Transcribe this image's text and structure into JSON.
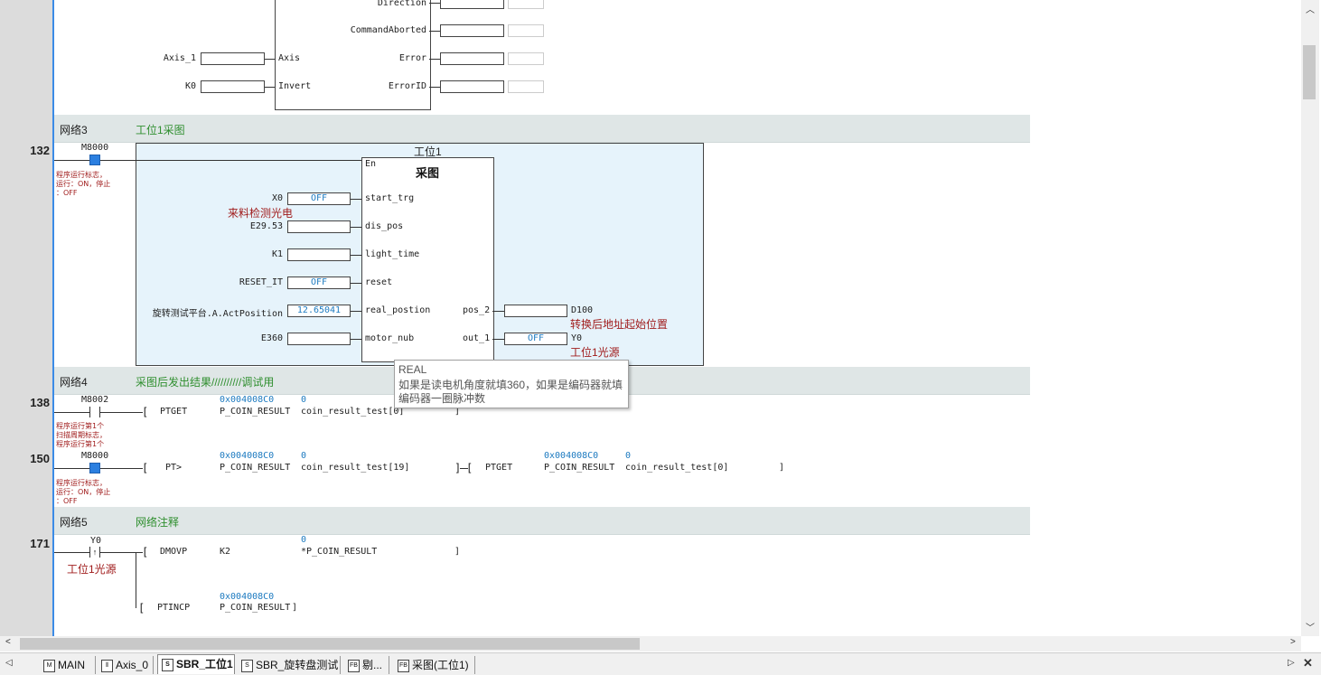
{
  "fb_top": {
    "pins_left": [
      {
        "label": "Axis_1",
        "pin": "Axis"
      },
      {
        "label": "K0",
        "pin": "Invert"
      }
    ],
    "pins_right": [
      "Direction",
      "CommandAborted",
      "Error",
      "ErrorID"
    ]
  },
  "rows": {
    "r132": "132",
    "r138": "138",
    "r150": "150",
    "r171": "171"
  },
  "networks": [
    {
      "name": "网络3",
      "comment": "工位1采图"
    },
    {
      "name": "网络4",
      "comment": "采图后发出结果//////////调试用"
    },
    {
      "name": "网络5",
      "comment": "网络注释"
    }
  ],
  "net3": {
    "contact": "M8000",
    "contact_comment": [
      "程序运行标志，",
      "运行：ON，停止",
      "：OFF"
    ],
    "instance": "工位1",
    "block_title": "采图",
    "en": "En",
    "inputs": [
      {
        "var": "X0",
        "value": "OFF",
        "pin": "start_trg",
        "comment": "来料检测光电"
      },
      {
        "var": "E29.53",
        "value": "",
        "pin": "dis_pos"
      },
      {
        "var": "K1",
        "value": "",
        "pin": "light_time"
      },
      {
        "var": "RESET_IT",
        "value": "OFF",
        "pin": "reset"
      },
      {
        "var": "旋转测试平台.A.ActPosition",
        "value": "12.65041",
        "pin": "real_postion"
      },
      {
        "var": "E360",
        "value": "",
        "pin": "motor_nub"
      }
    ],
    "outputs": [
      {
        "pin": "pos_2",
        "value": "",
        "var": "D100",
        "comment": "转换后地址起始位置"
      },
      {
        "pin": "out_1",
        "value": "OFF",
        "var": "Y0",
        "comment": "工位1光源"
      }
    ]
  },
  "tooltip": {
    "type": "REAL",
    "line1": "如果是读电机角度就填360，如果是编码器就填",
    "line2": "编码器一圈脉冲数"
  },
  "net4": {
    "r138": {
      "contact": "M8002",
      "comment": [
        "程序运行第1个",
        "扫描周期标志，",
        "程序运行第1个"
      ],
      "instr": "PTGET",
      "addr": "0x004008C0",
      "op1": "P_COIN_RESULT",
      "val": "0",
      "op2": "coin_result_test[0]",
      "close": "]"
    },
    "r150": {
      "contact": "M8000",
      "comment": [
        "程序运行标志，",
        "运行：ON，停止",
        "：OFF"
      ],
      "instr1": "PT>",
      "addr1": "0x004008C0",
      "op1": "P_COIN_RESULT",
      "val1": "0",
      "op1b": "coin_result_test[19]",
      "instr2": "PTGET",
      "addr2": "0x004008C0",
      "op2": "P_COIN_RESULT",
      "val2": "0",
      "op2b": "coin_result_test[0]",
      "close": "]"
    }
  },
  "net5": {
    "contact": "Y0",
    "contact_comment": "工位1光源",
    "instr1": "DMOVP",
    "op1": "K2",
    "val1": "0",
    "op1b": "*P_COIN_RESULT",
    "close": "]",
    "instr2": "PTINCP",
    "addr2": "0x004008C0",
    "op2": "P_COIN_RESULT",
    "close2": "]"
  },
  "tabs": [
    "MAIN",
    "Axis_0",
    "SBR_工位1",
    "SBR_旋转盘测试",
    "剔...",
    "采图(工位1)"
  ],
  "tab_icons": [
    "M",
    "⫴",
    "S",
    "S",
    "FB",
    "FB"
  ],
  "colors": {
    "accent": "#2b7fe0",
    "network_bg": "#dfe6e6",
    "fb_bg": "#e6f3fb",
    "comment_green": "#2f8f2f",
    "comment_red": "#a01c1c"
  }
}
